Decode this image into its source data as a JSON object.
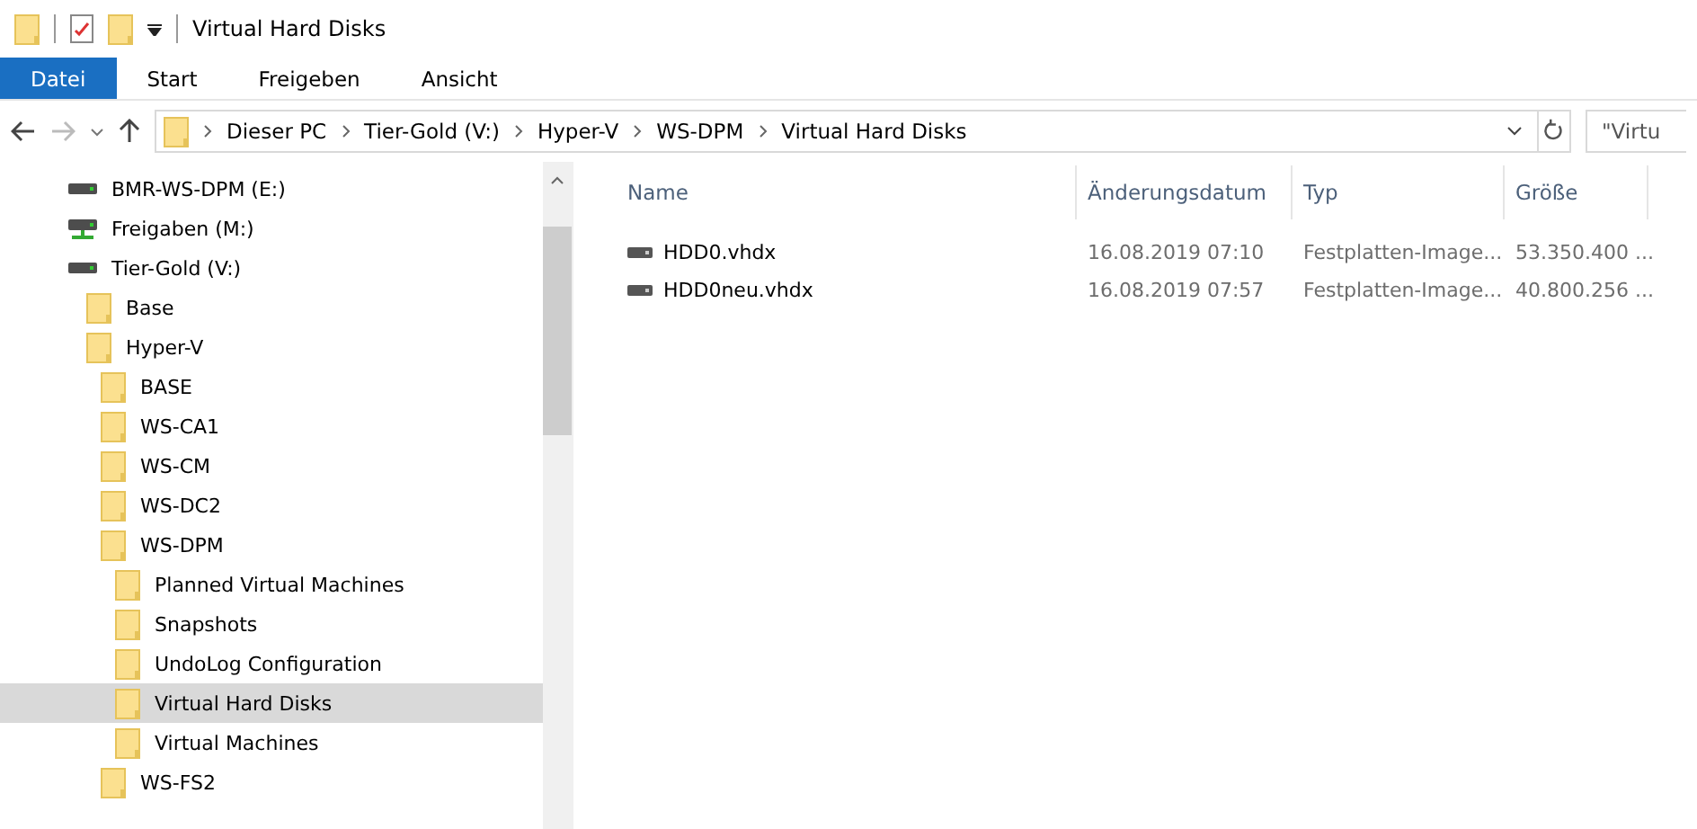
{
  "window": {
    "title": "Virtual Hard Disks"
  },
  "ribbon_tabs": [
    {
      "label": "Datei",
      "selected": true
    },
    {
      "label": "Start",
      "selected": false
    },
    {
      "label": "Freigeben",
      "selected": false
    },
    {
      "label": "Ansicht",
      "selected": false
    }
  ],
  "address_bar": {
    "path": [
      "Dieser PC",
      "Tier-Gold (V:)",
      "Hyper-V",
      "WS-DPM",
      "Virtual Hard Disks"
    ]
  },
  "search": {
    "placeholder": "\"Virtu"
  },
  "navigation": [
    {
      "label": "BMR-WS-DPM (E:)",
      "kind": "drive",
      "selected": false
    },
    {
      "label": "Freigaben (M:)",
      "kind": "network",
      "selected": false
    },
    {
      "label": "Tier-Gold (V:)",
      "kind": "drive",
      "selected": false,
      "children": [
        {
          "label": "Base",
          "kind": "folder",
          "selected": false
        },
        {
          "label": "Hyper-V",
          "kind": "folder",
          "selected": false,
          "children": [
            {
              "label": "BASE",
              "kind": "folder",
              "selected": false
            },
            {
              "label": "WS-CA1",
              "kind": "folder",
              "selected": false
            },
            {
              "label": "WS-CM",
              "kind": "folder",
              "selected": false
            },
            {
              "label": "WS-DC2",
              "kind": "folder",
              "selected": false
            },
            {
              "label": "WS-DPM",
              "kind": "folder",
              "selected": false,
              "children": [
                {
                  "label": "Planned Virtual Machines",
                  "kind": "folder",
                  "selected": false
                },
                {
                  "label": "Snapshots",
                  "kind": "folder",
                  "selected": false
                },
                {
                  "label": "UndoLog Configuration",
                  "kind": "folder",
                  "selected": false
                },
                {
                  "label": "Virtual Hard Disks",
                  "kind": "folder",
                  "selected": true
                },
                {
                  "label": "Virtual Machines",
                  "kind": "folder",
                  "selected": false
                }
              ]
            },
            {
              "label": "WS-FS2",
              "kind": "folder",
              "selected": false
            }
          ]
        }
      ]
    }
  ],
  "table": {
    "columns": [
      "Name",
      "Änderungsdatum",
      "Typ",
      "Größe"
    ],
    "rows": [
      [
        "HDD0.vhdx",
        "16.08.2019 07:10",
        "Festplatten-Image...",
        "53.350.400 ..."
      ],
      [
        "HDD0neu.vhdx",
        "16.08.2019 07:57",
        "Festplatten-Image...",
        "40.800.256 ..."
      ]
    ]
  }
}
